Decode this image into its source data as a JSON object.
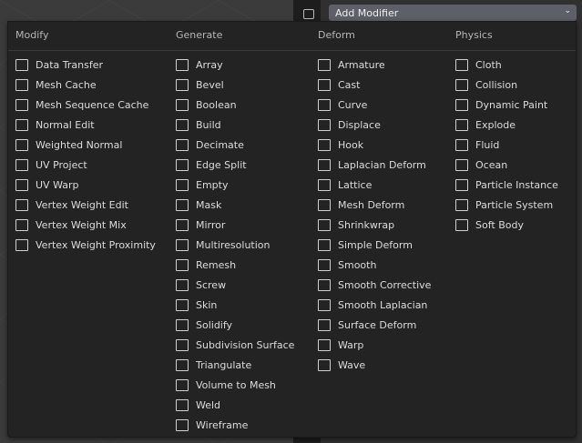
{
  "header_button": {
    "label": "Add Modifier",
    "chevron": "chevron-down-icon"
  },
  "menu": {
    "columns": [
      {
        "title": "Modify",
        "items": [
          "Data Transfer",
          "Mesh Cache",
          "Mesh Sequence Cache",
          "Normal Edit",
          "Weighted Normal",
          "UV Project",
          "UV Warp",
          "Vertex Weight Edit",
          "Vertex Weight Mix",
          "Vertex Weight Proximity"
        ]
      },
      {
        "title": "Generate",
        "items": [
          "Array",
          "Bevel",
          "Boolean",
          "Build",
          "Decimate",
          "Edge Split",
          "Empty",
          "Mask",
          "Mirror",
          "Multiresolution",
          "Remesh",
          "Screw",
          "Skin",
          "Solidify",
          "Subdivision Surface",
          "Triangulate",
          "Volume to Mesh",
          "Weld",
          "Wireframe"
        ]
      },
      {
        "title": "Deform",
        "items": [
          "Armature",
          "Cast",
          "Curve",
          "Displace",
          "Hook",
          "Laplacian Deform",
          "Lattice",
          "Mesh Deform",
          "Shrinkwrap",
          "Simple Deform",
          "Smooth",
          "Smooth Corrective",
          "Smooth Laplacian",
          "Surface Deform",
          "Warp",
          "Wave"
        ]
      },
      {
        "title": "Physics",
        "items": [
          "Cloth",
          "Collision",
          "Dynamic Paint",
          "Explode",
          "Fluid",
          "Ocean",
          "Particle Instance",
          "Particle System",
          "Soft Body"
        ]
      }
    ]
  }
}
